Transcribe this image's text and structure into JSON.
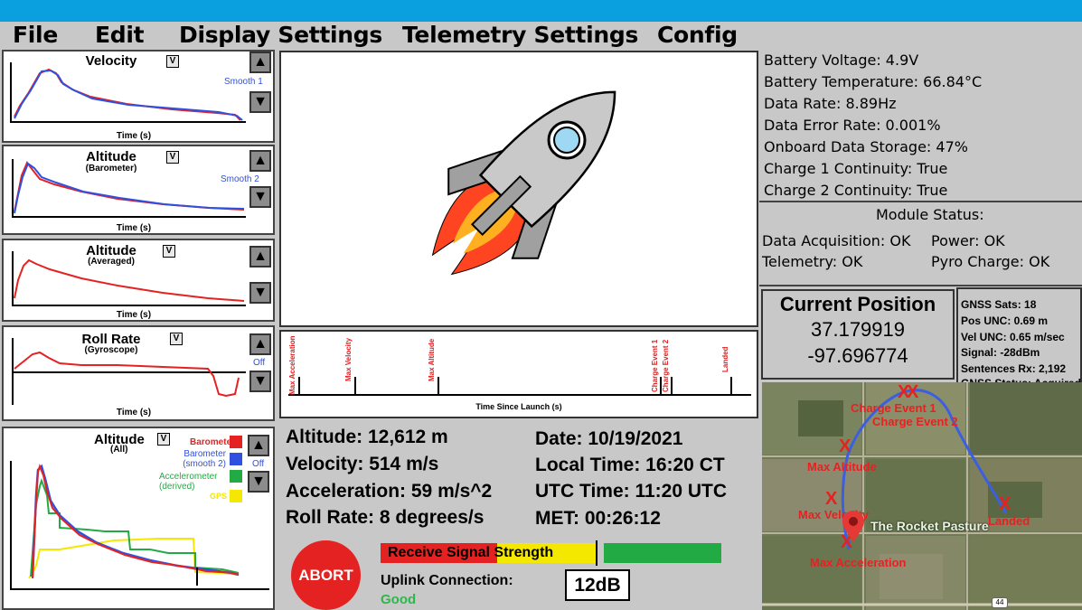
{
  "menu": [
    "File",
    "Edit",
    "Display Settings",
    "Telemetry Settings",
    "Config"
  ],
  "graphs": {
    "velocity": {
      "title": "Velocity",
      "xlabel": "Time (s)",
      "smooth": "Smooth 1"
    },
    "altitude_baro": {
      "title": "Altitude",
      "subtitle": "(Barometer)",
      "xlabel": "Time (s)",
      "smooth": "Smooth 2"
    },
    "altitude_avg": {
      "title": "Altitude",
      "subtitle": "(Averaged)",
      "xlabel": "Time (s)"
    },
    "roll_rate": {
      "title": "Roll Rate",
      "subtitle": "(Gyroscope)",
      "xlabel": "Time (s)",
      "smooth": "Off"
    },
    "altitude_all": {
      "title": "Altitude",
      "subtitle": "(All)",
      "smooth": "Off",
      "legend": [
        {
          "label": "Barometer",
          "color": "#e52222"
        },
        {
          "label": "Barometer (smooth 2)",
          "line1": "Barometer",
          "line2": "(smooth 2)",
          "color": "#3050e0"
        },
        {
          "label": "Accelerometer (derived)",
          "line1": "Accelerometer",
          "line2": "(derived)",
          "color": "#22aa44"
        },
        {
          "label": "GPS",
          "color": "#f5e800"
        }
      ]
    }
  },
  "dropdown_glyph": "V",
  "up_glyph": "▲",
  "down_glyph": "▼",
  "timeline": {
    "xlabel": "Time Since Launch (s)",
    "events": [
      "Max Acceleration",
      "Max Velocity",
      "Max Altitude",
      "Charge Event 1",
      "Charge Event 2",
      "Landed"
    ]
  },
  "readouts": {
    "altitude": "Altitude: 12,612 m",
    "velocity": "Velocity:  514 m/s",
    "acceleration": "Acceleration: 59 m/s^2",
    "roll_rate": "Roll Rate: 8 degrees/s",
    "date": "Date: 10/19/2021",
    "local_time": "Local Time: 16:20 CT",
    "utc_time": "UTC Time: 11:20 UTC",
    "met": "MET: 00:26:12"
  },
  "status": {
    "battery_voltage": "Battery Voltage: 4.9V",
    "battery_temperature": "Battery Temperature: 66.84°C",
    "data_rate": "Data Rate: 8.89Hz",
    "data_error_rate": "Data Error Rate: 0.001%",
    "onboard_storage": "Onboard Data Storage: 47%",
    "charge1": "Charge 1 Continuity: True",
    "charge2": "Charge 2 Continuity: True"
  },
  "modules": {
    "title": "Module Status:",
    "data_acq": "Data Acquisition: OK",
    "power": "Power: OK",
    "telemetry": "Telemetry: OK",
    "pyro": "Pyro Charge: OK"
  },
  "position": {
    "title": "Current Position",
    "lat": "37.179919",
    "lon": "-97.696774"
  },
  "gnss": {
    "sats": "GNSS Sats: 18",
    "pos_unc": "Pos UNC: 0.69 m",
    "vel_unc": "Vel UNC: 0.65 m/sec",
    "signal": "Signal: -28dBm",
    "sentences": "Sentences Rx: 2,192",
    "status": "GNSS Status: Acquired"
  },
  "map": {
    "marker_x": "X",
    "labels": {
      "charge1": "Charge Event 1",
      "charge2": "Charge Event 2",
      "max_alt": "Max Altitude",
      "max_vel": "Max Velocity",
      "landed": "Landed",
      "max_acc": "Max Acceleration",
      "place": "The Rocket Pasture",
      "road": "44"
    }
  },
  "controls": {
    "abort": "ABORT",
    "signal_label": "Receive Signal Strength",
    "signal_level": 0.65,
    "uplink_label": "Uplink Connection:",
    "uplink_value": "Good",
    "db_value": "12dB"
  }
}
